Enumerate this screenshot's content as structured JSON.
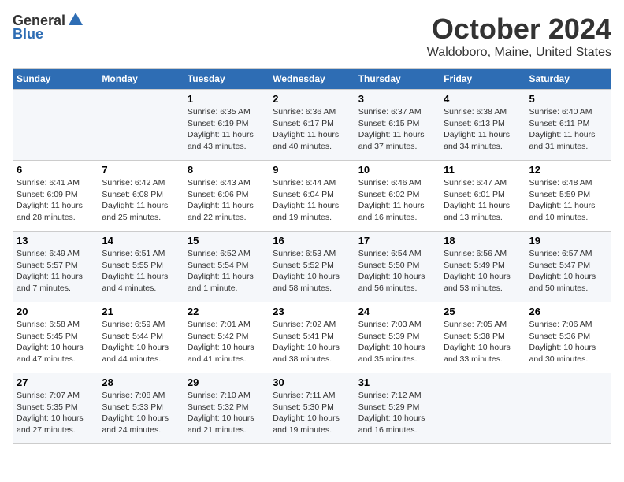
{
  "header": {
    "logo_general": "General",
    "logo_blue": "Blue",
    "month_title": "October 2024",
    "location": "Waldoboro, Maine, United States"
  },
  "weekdays": [
    "Sunday",
    "Monday",
    "Tuesday",
    "Wednesday",
    "Thursday",
    "Friday",
    "Saturday"
  ],
  "weeks": [
    [
      {
        "day": "",
        "sunrise": "",
        "sunset": "",
        "daylight": ""
      },
      {
        "day": "",
        "sunrise": "",
        "sunset": "",
        "daylight": ""
      },
      {
        "day": "1",
        "sunrise": "Sunrise: 6:35 AM",
        "sunset": "Sunset: 6:19 PM",
        "daylight": "Daylight: 11 hours and 43 minutes."
      },
      {
        "day": "2",
        "sunrise": "Sunrise: 6:36 AM",
        "sunset": "Sunset: 6:17 PM",
        "daylight": "Daylight: 11 hours and 40 minutes."
      },
      {
        "day": "3",
        "sunrise": "Sunrise: 6:37 AM",
        "sunset": "Sunset: 6:15 PM",
        "daylight": "Daylight: 11 hours and 37 minutes."
      },
      {
        "day": "4",
        "sunrise": "Sunrise: 6:38 AM",
        "sunset": "Sunset: 6:13 PM",
        "daylight": "Daylight: 11 hours and 34 minutes."
      },
      {
        "day": "5",
        "sunrise": "Sunrise: 6:40 AM",
        "sunset": "Sunset: 6:11 PM",
        "daylight": "Daylight: 11 hours and 31 minutes."
      }
    ],
    [
      {
        "day": "6",
        "sunrise": "Sunrise: 6:41 AM",
        "sunset": "Sunset: 6:09 PM",
        "daylight": "Daylight: 11 hours and 28 minutes."
      },
      {
        "day": "7",
        "sunrise": "Sunrise: 6:42 AM",
        "sunset": "Sunset: 6:08 PM",
        "daylight": "Daylight: 11 hours and 25 minutes."
      },
      {
        "day": "8",
        "sunrise": "Sunrise: 6:43 AM",
        "sunset": "Sunset: 6:06 PM",
        "daylight": "Daylight: 11 hours and 22 minutes."
      },
      {
        "day": "9",
        "sunrise": "Sunrise: 6:44 AM",
        "sunset": "Sunset: 6:04 PM",
        "daylight": "Daylight: 11 hours and 19 minutes."
      },
      {
        "day": "10",
        "sunrise": "Sunrise: 6:46 AM",
        "sunset": "Sunset: 6:02 PM",
        "daylight": "Daylight: 11 hours and 16 minutes."
      },
      {
        "day": "11",
        "sunrise": "Sunrise: 6:47 AM",
        "sunset": "Sunset: 6:01 PM",
        "daylight": "Daylight: 11 hours and 13 minutes."
      },
      {
        "day": "12",
        "sunrise": "Sunrise: 6:48 AM",
        "sunset": "Sunset: 5:59 PM",
        "daylight": "Daylight: 11 hours and 10 minutes."
      }
    ],
    [
      {
        "day": "13",
        "sunrise": "Sunrise: 6:49 AM",
        "sunset": "Sunset: 5:57 PM",
        "daylight": "Daylight: 11 hours and 7 minutes."
      },
      {
        "day": "14",
        "sunrise": "Sunrise: 6:51 AM",
        "sunset": "Sunset: 5:55 PM",
        "daylight": "Daylight: 11 hours and 4 minutes."
      },
      {
        "day": "15",
        "sunrise": "Sunrise: 6:52 AM",
        "sunset": "Sunset: 5:54 PM",
        "daylight": "Daylight: 11 hours and 1 minute."
      },
      {
        "day": "16",
        "sunrise": "Sunrise: 6:53 AM",
        "sunset": "Sunset: 5:52 PM",
        "daylight": "Daylight: 10 hours and 58 minutes."
      },
      {
        "day": "17",
        "sunrise": "Sunrise: 6:54 AM",
        "sunset": "Sunset: 5:50 PM",
        "daylight": "Daylight: 10 hours and 56 minutes."
      },
      {
        "day": "18",
        "sunrise": "Sunrise: 6:56 AM",
        "sunset": "Sunset: 5:49 PM",
        "daylight": "Daylight: 10 hours and 53 minutes."
      },
      {
        "day": "19",
        "sunrise": "Sunrise: 6:57 AM",
        "sunset": "Sunset: 5:47 PM",
        "daylight": "Daylight: 10 hours and 50 minutes."
      }
    ],
    [
      {
        "day": "20",
        "sunrise": "Sunrise: 6:58 AM",
        "sunset": "Sunset: 5:45 PM",
        "daylight": "Daylight: 10 hours and 47 minutes."
      },
      {
        "day": "21",
        "sunrise": "Sunrise: 6:59 AM",
        "sunset": "Sunset: 5:44 PM",
        "daylight": "Daylight: 10 hours and 44 minutes."
      },
      {
        "day": "22",
        "sunrise": "Sunrise: 7:01 AM",
        "sunset": "Sunset: 5:42 PM",
        "daylight": "Daylight: 10 hours and 41 minutes."
      },
      {
        "day": "23",
        "sunrise": "Sunrise: 7:02 AM",
        "sunset": "Sunset: 5:41 PM",
        "daylight": "Daylight: 10 hours and 38 minutes."
      },
      {
        "day": "24",
        "sunrise": "Sunrise: 7:03 AM",
        "sunset": "Sunset: 5:39 PM",
        "daylight": "Daylight: 10 hours and 35 minutes."
      },
      {
        "day": "25",
        "sunrise": "Sunrise: 7:05 AM",
        "sunset": "Sunset: 5:38 PM",
        "daylight": "Daylight: 10 hours and 33 minutes."
      },
      {
        "day": "26",
        "sunrise": "Sunrise: 7:06 AM",
        "sunset": "Sunset: 5:36 PM",
        "daylight": "Daylight: 10 hours and 30 minutes."
      }
    ],
    [
      {
        "day": "27",
        "sunrise": "Sunrise: 7:07 AM",
        "sunset": "Sunset: 5:35 PM",
        "daylight": "Daylight: 10 hours and 27 minutes."
      },
      {
        "day": "28",
        "sunrise": "Sunrise: 7:08 AM",
        "sunset": "Sunset: 5:33 PM",
        "daylight": "Daylight: 10 hours and 24 minutes."
      },
      {
        "day": "29",
        "sunrise": "Sunrise: 7:10 AM",
        "sunset": "Sunset: 5:32 PM",
        "daylight": "Daylight: 10 hours and 21 minutes."
      },
      {
        "day": "30",
        "sunrise": "Sunrise: 7:11 AM",
        "sunset": "Sunset: 5:30 PM",
        "daylight": "Daylight: 10 hours and 19 minutes."
      },
      {
        "day": "31",
        "sunrise": "Sunrise: 7:12 AM",
        "sunset": "Sunset: 5:29 PM",
        "daylight": "Daylight: 10 hours and 16 minutes."
      },
      {
        "day": "",
        "sunrise": "",
        "sunset": "",
        "daylight": ""
      },
      {
        "day": "",
        "sunrise": "",
        "sunset": "",
        "daylight": ""
      }
    ]
  ]
}
